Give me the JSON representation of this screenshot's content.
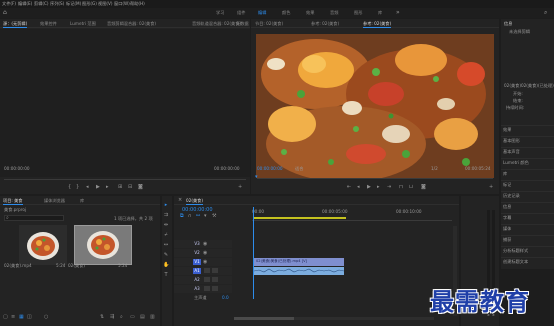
{
  "menubar": {
    "items": [
      "文件(F)",
      "编辑(E)",
      "剪辑(C)",
      "序列(S)",
      "标记(M)",
      "图形(G)",
      "视图(V)",
      "窗口(W)",
      "帮助(H)"
    ]
  },
  "workspaces": [
    "学习",
    "组件",
    "编辑",
    "颜色",
    "效果",
    "音频",
    "图形",
    "库"
  ],
  "source_panel": {
    "tabs": [
      "源：(无剪辑)",
      "效果控件",
      "Lumetri 范围",
      "音频剪辑混合器: 02(美食)",
      "音频轨道混合器: 02(美食)",
      "元数据"
    ],
    "timecode_left": "00:00:00:00",
    "timecode_right": "00:00:00:00"
  },
  "program_panel": {
    "tabs": [
      "节目: 02(美食)",
      "参考: 02(美食)",
      "参考: 02(美食)"
    ],
    "timecode": "00:00:00:00",
    "zoom": "适合",
    "fraction": "1/2",
    "duration": "00:00:05:24"
  },
  "project_panel": {
    "tabs": [
      "项目: 美食",
      "媒体浏览器",
      "库"
    ],
    "project_file": "美食.prproj",
    "search_placeholder": "",
    "items_count": "1 项已选择，共 2 项",
    "clips": [
      {
        "name": "02(美食).mp4",
        "duration": "5:24"
      },
      {
        "name": "02(美食)",
        "duration": "5:24"
      }
    ]
  },
  "timeline": {
    "tab": "02(美食)",
    "timecode": "00:00:00:00",
    "ruler": [
      "00:00",
      "00:00:05:00",
      "00:00:10:00"
    ],
    "tracks": [
      {
        "name": "V3",
        "selected": false
      },
      {
        "name": "V2",
        "selected": false
      },
      {
        "name": "V1",
        "selected": true
      },
      {
        "name": "A1",
        "selected": true
      },
      {
        "name": "A2",
        "selected": false
      },
      {
        "name": "A3",
        "selected": false
      }
    ],
    "master_label": "主声道",
    "master_value": "0.0",
    "video_clip": "02(美食)美食(已处理).mp4 [V]",
    "colors": {
      "video_clip": "#7f8fcf",
      "audio_clip": "#7caddf",
      "playhead": "#2d8ceb",
      "work_area": "#c4c21f"
    }
  },
  "right_panel": {
    "header": "信息",
    "subheader": "未选择剪辑",
    "clip_name": "02(美食)02(美食)(已处理)",
    "props": [
      "开始:",
      "结束:",
      "持续时间:"
    ],
    "items": [
      "效果",
      "基本图形",
      "基本声音",
      "Lumetri 颜色",
      "库",
      "标记",
      "历史记录",
      "信息",
      "字幕",
      "媒体",
      "捕获",
      "分析标题样式",
      "创建标题文本",
      "调整图层",
      "创建"
    ]
  },
  "watermark": "最需教育"
}
